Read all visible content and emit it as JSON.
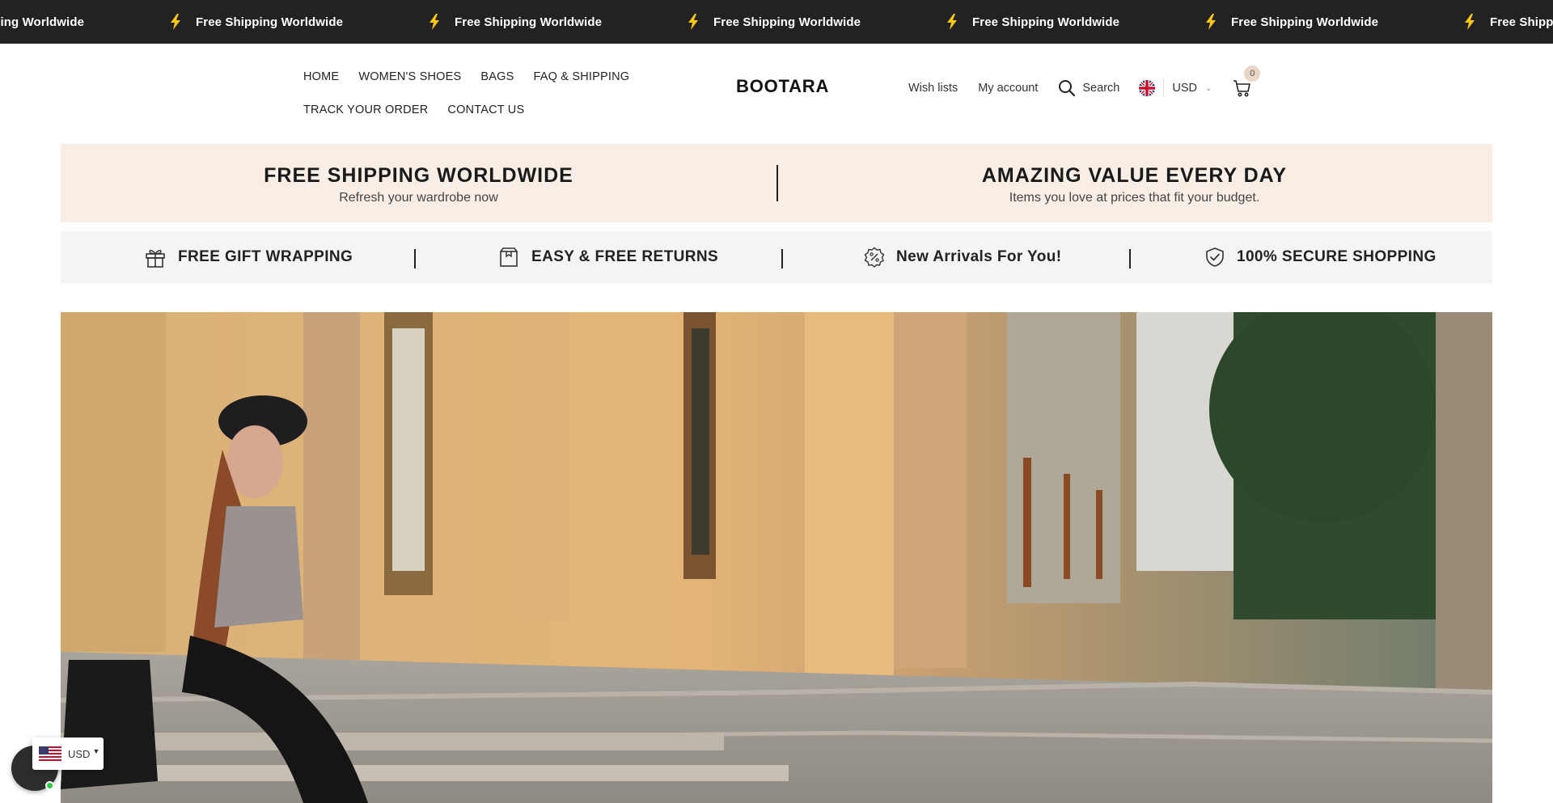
{
  "announcement": {
    "icon": "lightning-bolt-icon",
    "items": [
      "Free Shipping Worldwide",
      "Free Shipping Worldwide",
      "Free Shipping Worldwide",
      "Free Shipping Worldwide",
      "Free Shipping Worldwide",
      "Free Shipping Worldwide",
      "Free Shipping Worldwide"
    ]
  },
  "header": {
    "nav": {
      "row1": [
        "HOME",
        "WOMEN'S SHOES",
        "BAGS",
        "FAQ & SHIPPING"
      ],
      "row2": [
        "TRACK YOUR ORDER",
        "CONTACT US"
      ]
    },
    "logo": "BOOTARA",
    "wish_lists": "Wish lists",
    "my_account": "My account",
    "search": "Search",
    "currency": "USD",
    "cart_count": "0"
  },
  "promo": {
    "left": {
      "title": "FREE SHIPPING WORLDWIDE",
      "subtitle": "Refresh your wardrobe now"
    },
    "right": {
      "title": "AMAZING VALUE EVERY DAY",
      "subtitle": "Items you love at prices that fit your budget."
    }
  },
  "features": [
    {
      "icon": "gift-icon",
      "label": "FREE GIFT WRAPPING"
    },
    {
      "icon": "box-icon",
      "label": "EASY & FREE RETURNS"
    },
    {
      "icon": "percent-badge-icon",
      "label": "New Arrivals For You!"
    },
    {
      "icon": "shield-check-icon",
      "label": "100% SECURE SHOPPING"
    }
  ],
  "currency_widget": {
    "label": "USD"
  },
  "colors": {
    "announcement_bg": "#222222",
    "bolt": "#f5c518",
    "promo_bg": "#f8eee5",
    "features_bg": "#f4f4f4",
    "badge": "#e8d6c9"
  }
}
